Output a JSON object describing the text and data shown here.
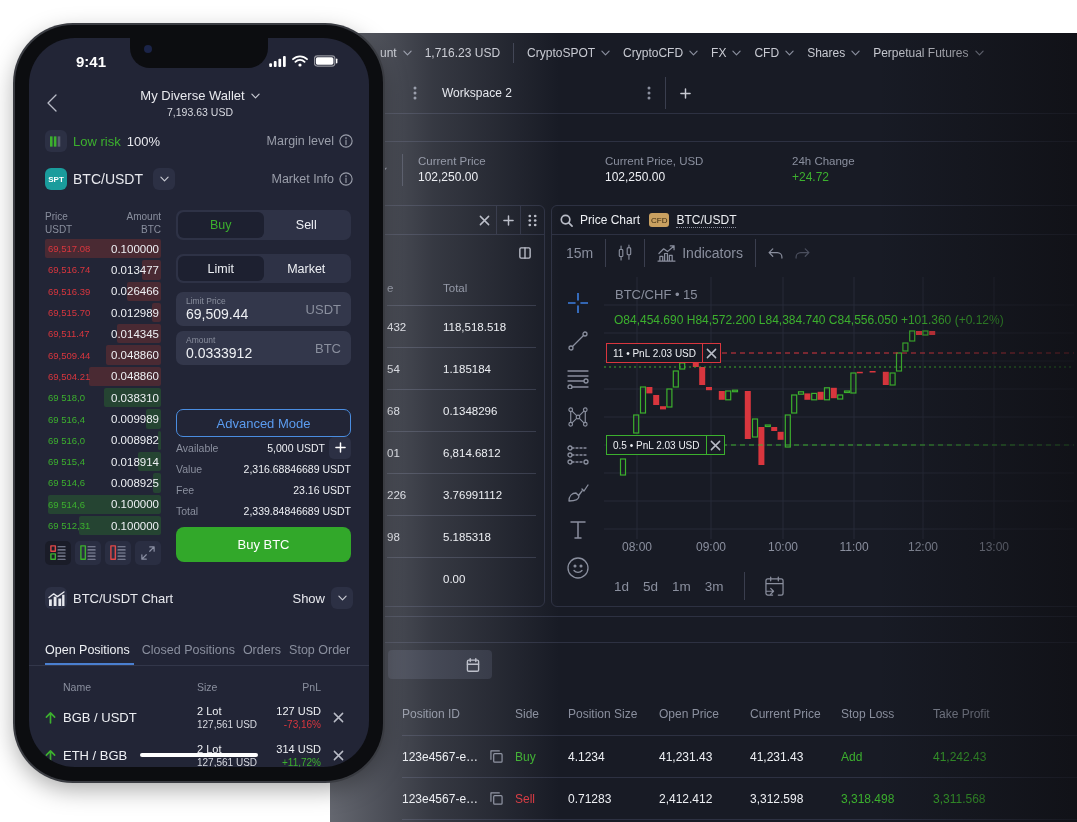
{
  "phone": {
    "status_bar": {
      "time": "9:41"
    },
    "header": {
      "wallet": "My Diverse Wallet",
      "balance": "7,193.63 USD"
    },
    "risk": {
      "label": "Low risk",
      "value": "100%",
      "margin_label": "Margin level"
    },
    "pair": {
      "badge": "SPT",
      "symbol": "BTC/USDT",
      "info_label": "Market Info"
    },
    "order_book": {
      "columns": [
        {
          "title": "Price",
          "unit": "USDT"
        },
        {
          "title": "Amount",
          "unit": "BTC"
        }
      ],
      "rows": [
        {
          "kind": "ask",
          "price": "69,517.08",
          "amount": "0.100000"
        },
        {
          "kind": "ask",
          "price": "69,516.74",
          "amount": "0.013477"
        },
        {
          "kind": "ask",
          "price": "69,516.39",
          "amount": "0.026466"
        },
        {
          "kind": "ask",
          "price": "69,515.70",
          "amount": "0.012989"
        },
        {
          "kind": "ask",
          "price": "69,511.47",
          "amount": "0.014345"
        },
        {
          "kind": "ask",
          "price": "69,509.44",
          "amount": "0.048860"
        },
        {
          "kind": "ask",
          "price": "69,504.21",
          "amount": "0.048860"
        },
        {
          "kind": "bid",
          "price": "69 518,0",
          "amount": "0.038310"
        },
        {
          "kind": "bid",
          "price": "69 516,4",
          "amount": "0.009989"
        },
        {
          "kind": "bid",
          "price": "69 516,0",
          "amount": "0.008982"
        },
        {
          "kind": "bid",
          "price": "69 515,4",
          "amount": "0.018914"
        },
        {
          "kind": "bid",
          "price": "69 514,6",
          "amount": "0.008925"
        },
        {
          "kind": "bid",
          "price": "69 514,6",
          "amount": "0.100000"
        },
        {
          "kind": "bid",
          "price": "69 512,31",
          "amount": "0.100000"
        }
      ],
      "views": [
        {
          "kind": "both",
          "selected": true
        },
        {
          "kind": "bids",
          "selected": false
        },
        {
          "kind": "asks",
          "selected": false
        },
        {
          "kind": "expand",
          "selected": false
        }
      ]
    },
    "order_form": {
      "sides": [
        {
          "label": "Buy",
          "kind": "buy",
          "selected": true
        },
        {
          "label": "Sell",
          "kind": "sell",
          "selected": false
        }
      ],
      "types": [
        {
          "label": "Limit",
          "selected": true
        },
        {
          "label": "Market",
          "selected": false
        }
      ],
      "fields": [
        {
          "label": "Limit Price",
          "value": "69,509.44",
          "unit": "USDT"
        },
        {
          "label": "Amount",
          "value": "0.0333912",
          "unit": "BTC"
        }
      ],
      "advanced_button": "Advanced Mode",
      "summary": [
        {
          "label": "Available",
          "value": "5,000 USDT",
          "add": true
        },
        {
          "label": "Value",
          "value": "2,316.68846689 USDT",
          "add": false
        },
        {
          "label": "Fee",
          "value": "23.16 USDT",
          "add": false
        },
        {
          "label": "Total",
          "value": "2,339.84846689 USDT",
          "add": false
        }
      ],
      "submit": "Buy BTC"
    },
    "chart_toggle": {
      "title": "BTC/USDT Chart",
      "action": "Show"
    },
    "tabs": [
      {
        "label": "Open Positions",
        "selected": true
      },
      {
        "label": "Closed Positions",
        "selected": false
      },
      {
        "label": "Orders",
        "selected": false
      },
      {
        "label": "Stop Order",
        "selected": false
      }
    ],
    "positions": {
      "columns": [
        "Name",
        "Size",
        "PnL"
      ],
      "rows": [
        {
          "name": "BGB / USDT",
          "long": true,
          "size": "2 Lot",
          "size_value": "127,561 USD",
          "pnl": "127 USD",
          "pnl_percent": "-73,16%",
          "kind": "loss"
        },
        {
          "name": "ETH / BGB",
          "long": true,
          "size": "2 Lot",
          "size_value": "127,561 USD",
          "pnl": "314 USD",
          "pnl_percent": "+11,72%",
          "kind": "gain"
        }
      ]
    }
  },
  "desktop": {
    "nav": {
      "account": "unt",
      "balance": "1,716.23 USD",
      "markets": [
        "CryptoSPOT",
        "CryptoCFD",
        "FX",
        "CFD",
        "Shares",
        "Perpetual Futures"
      ]
    },
    "workspace": {
      "name": "Workspace 2"
    },
    "ticker": [
      {
        "label": "Current Price",
        "value": "102,250.00",
        "kind": "price"
      },
      {
        "label": "Current Price, USD",
        "value": "102,250.00",
        "kind": "price"
      },
      {
        "label": "24h Change",
        "value": "+24.72",
        "kind": "gain"
      }
    ],
    "trades_table": {
      "columns": [
        "e",
        "Total"
      ],
      "rows": [
        {
          "column_1": "432",
          "total": "118,518.518"
        },
        {
          "column_1": "54",
          "total": "1.185184"
        },
        {
          "column_1": "68",
          "total": "0.1348296"
        },
        {
          "column_1": "01",
          "total": "6,814.6812"
        },
        {
          "column_1": "226",
          "total": "3.76991112"
        },
        {
          "column_1": "98",
          "total": "5.185318"
        },
        {
          "total": "0.00"
        }
      ]
    },
    "price_chart": {
      "title": "Price Chart",
      "badge": "CFD",
      "symbol": "BTC/USDT",
      "interval": "15m",
      "indicators": "Indicators",
      "legend": "BTC/CHF • 15",
      "ohlc": "O84,454.690 H84,572.200 L84,384.740 C84,556.050 +101.360 (+0.12%)",
      "position_labels": [
        {
          "label": "11 • PnL 2.03 USD",
          "kind": "sell"
        },
        {
          "label": "0.5 • PnL 2.03 USD",
          "kind": "buy"
        }
      ],
      "time_ticks": [
        "08:00",
        "09:00",
        "10:00",
        "11:00",
        "12:00",
        "13:00"
      ],
      "ranges": [
        "1d",
        "5d",
        "1m",
        "3m"
      ]
    },
    "positions_table": {
      "columns": [
        "Position ID",
        "Side",
        "Position Size",
        "Open Price",
        "Current Price",
        "Stop Loss",
        "Take Profit"
      ],
      "rows": [
        {
          "id": "123e4567-e…",
          "side": "Buy",
          "kind": "buy",
          "size": "4.1234",
          "open": "41,231.43",
          "current": "41,231.43",
          "stop_loss": "Add",
          "take_profit": "41,242.43"
        },
        {
          "id": "123e4567-e…",
          "side": "Sell",
          "kind": "sell",
          "size": "0.71283",
          "open": "2,412.412",
          "current": "3,312.598",
          "stop_loss": "3,318.498",
          "take_profit": "3,311.568"
        }
      ]
    }
  }
}
